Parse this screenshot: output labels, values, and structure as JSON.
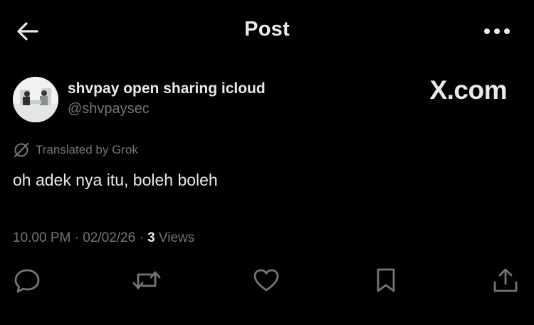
{
  "header": {
    "title": "Post",
    "back_icon": "arrow-left-icon",
    "more_icon": "more-horizontal-icon"
  },
  "post": {
    "author_name": "shvpay open sharing icloud",
    "author_handle": "@shvpaysec",
    "translation_label": "Translated by Grok",
    "text": "oh adek nya itu, boleh boleh",
    "timestamp": "10.00 PM · 02/02/26 · ",
    "views_count": "3",
    "views_label": " Views"
  },
  "watermark": "X.com",
  "actions": {
    "reply_icon": "reply-icon",
    "repost_icon": "repost-icon",
    "like_icon": "heart-icon",
    "bookmark_icon": "bookmark-icon",
    "share_icon": "share-icon"
  },
  "colors": {
    "background": "#000000",
    "text_primary": "#e7e9ea",
    "text_secondary": "#71767b"
  }
}
